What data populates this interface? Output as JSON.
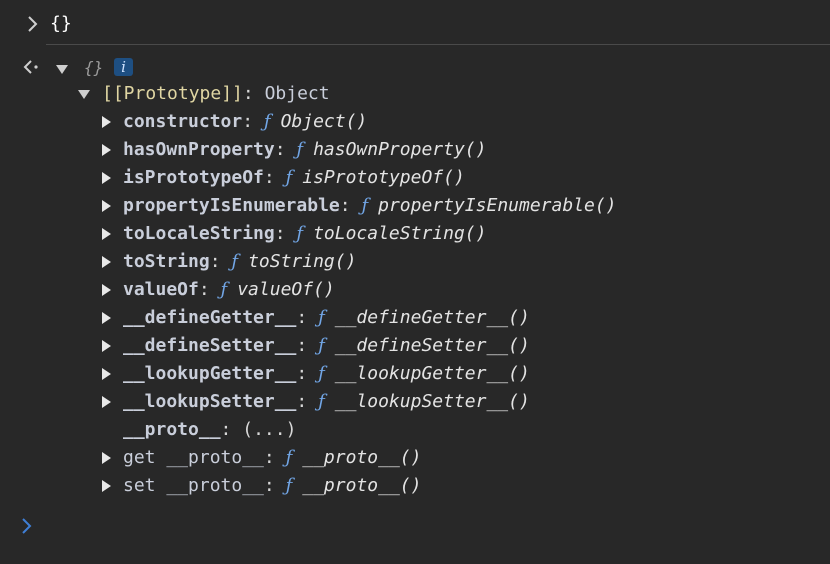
{
  "input": {
    "text": "{}"
  },
  "result": {
    "preview": "{}",
    "info_badge": "i",
    "prototype_key": "[[Prototype]]",
    "prototype_sep": ": ",
    "prototype_value": "Object"
  },
  "properties": [
    {
      "key": "constructor",
      "sep": ": ",
      "f": "ƒ",
      "value": "Object()",
      "expandable": true,
      "style": "bold"
    },
    {
      "key": "hasOwnProperty",
      "sep": ": ",
      "f": "ƒ",
      "value": "hasOwnProperty()",
      "expandable": true,
      "style": "bold"
    },
    {
      "key": "isPrototypeOf",
      "sep": ": ",
      "f": "ƒ",
      "value": "isPrototypeOf()",
      "expandable": true,
      "style": "bold"
    },
    {
      "key": "propertyIsEnumerable",
      "sep": ": ",
      "f": "ƒ",
      "value": "propertyIsEnumerable()",
      "expandable": true,
      "style": "bold"
    },
    {
      "key": "toLocaleString",
      "sep": ": ",
      "f": "ƒ",
      "value": "toLocaleString()",
      "expandable": true,
      "style": "bold"
    },
    {
      "key": "toString",
      "sep": ": ",
      "f": "ƒ",
      "value": "toString()",
      "expandable": true,
      "style": "bold"
    },
    {
      "key": "valueOf",
      "sep": ": ",
      "f": "ƒ",
      "value": "valueOf()",
      "expandable": true,
      "style": "bold"
    },
    {
      "key": "__defineGetter__",
      "sep": ": ",
      "f": "ƒ",
      "value": "__defineGetter__()",
      "expandable": true,
      "style": "bold"
    },
    {
      "key": "__defineSetter__",
      "sep": ": ",
      "f": "ƒ",
      "value": "__defineSetter__()",
      "expandable": true,
      "style": "bold"
    },
    {
      "key": "__lookupGetter__",
      "sep": ": ",
      "f": "ƒ",
      "value": "__lookupGetter__()",
      "expandable": true,
      "style": "bold"
    },
    {
      "key": "__lookupSetter__",
      "sep": ": ",
      "f": "ƒ",
      "value": "__lookupSetter__()",
      "expandable": true,
      "style": "bold"
    },
    {
      "key": "__proto__",
      "sep": ": ",
      "f": "",
      "value": "(...)",
      "expandable": false,
      "style": "bold"
    },
    {
      "key": "get __proto__",
      "sep": ": ",
      "f": "ƒ",
      "value": "__proto__()",
      "expandable": true,
      "style": "plain"
    },
    {
      "key": "set __proto__",
      "sep": ": ",
      "f": "ƒ",
      "value": "__proto__()",
      "expandable": true,
      "style": "plain"
    }
  ]
}
